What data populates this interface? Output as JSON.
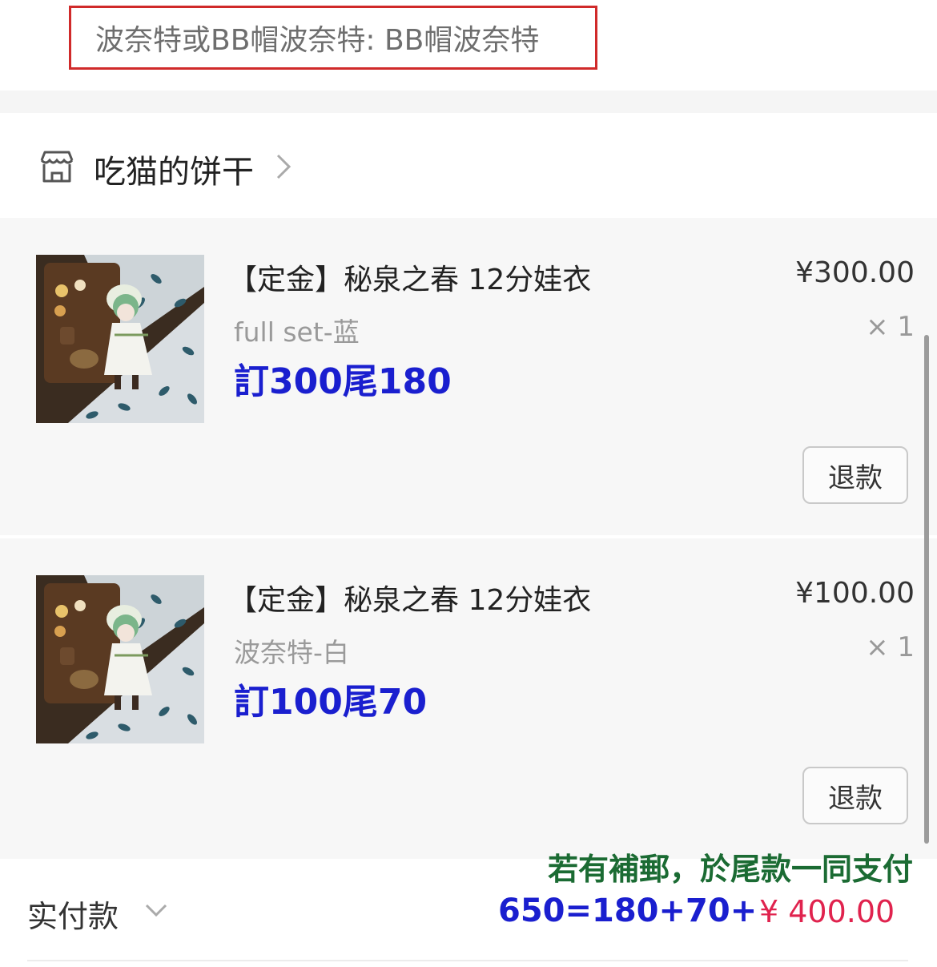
{
  "variant_box": {
    "text": "波奈特或BB帽波奈特: BB帽波奈特"
  },
  "shop": {
    "name": "吃猫的饼干",
    "icon": "store-icon"
  },
  "items": [
    {
      "title": "【定金】秘泉之春 12分娃衣",
      "price": "¥300.00",
      "spec": "full set-蓝",
      "qty": "× 1",
      "note": "訂300尾180",
      "refund_label": "退款"
    },
    {
      "title": "【定金】秘泉之春 12分娃衣",
      "price": "¥100.00",
      "spec": "波奈特-白",
      "qty": "× 1",
      "note": "訂100尾70",
      "refund_label": "退款"
    }
  ],
  "summary": {
    "paid_label": "实付款",
    "shipping_note": "若有補郵，於尾款一同支付",
    "calc_note": "650=180+70+",
    "total": "¥ 400.00"
  },
  "colors": {
    "accent_red": "#e0234e",
    "annotation_blue": "#1a1fcf",
    "annotation_green": "#1b6b33",
    "highlight_border": "#d02a2a"
  }
}
